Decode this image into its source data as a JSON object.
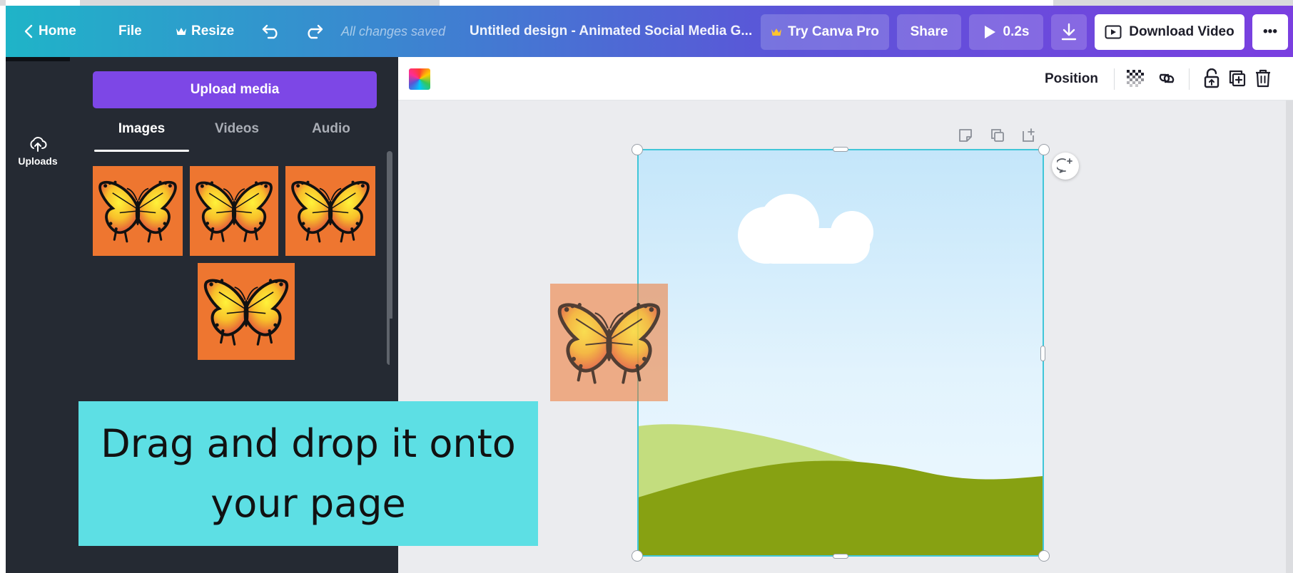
{
  "header": {
    "home_label": "Home",
    "file_label": "File",
    "resize_label": "Resize",
    "saved_status": "All changes saved",
    "design_title": "Untitled design - Animated Social Media G...",
    "try_pro_label": "Try Canva Pro",
    "share_label": "Share",
    "play_label": "0.2s",
    "download_video_label": "Download Video",
    "more_label": "•••"
  },
  "rail": {
    "uploads_label": "Uploads"
  },
  "panel": {
    "upload_button_label": "Upload media",
    "tabs": [
      {
        "label": "Images",
        "active": true
      },
      {
        "label": "Videos",
        "active": false
      },
      {
        "label": "Audio",
        "active": false
      }
    ],
    "thumbnail_count": 4,
    "thumbnail_color": "#ee7630"
  },
  "toolbar": {
    "position_label": "Position"
  },
  "canvas": {
    "sky_top": "#c4e6fa",
    "hill_light": "#c3dd7e",
    "hill_dark": "#87a112",
    "selection_color": "#40c6d8"
  },
  "caption": {
    "text": "Drag and drop it onto your page",
    "background": "#5ddfe4"
  },
  "colors": {
    "accent_purple": "#7d47e6",
    "panel_bg": "#252a33"
  }
}
